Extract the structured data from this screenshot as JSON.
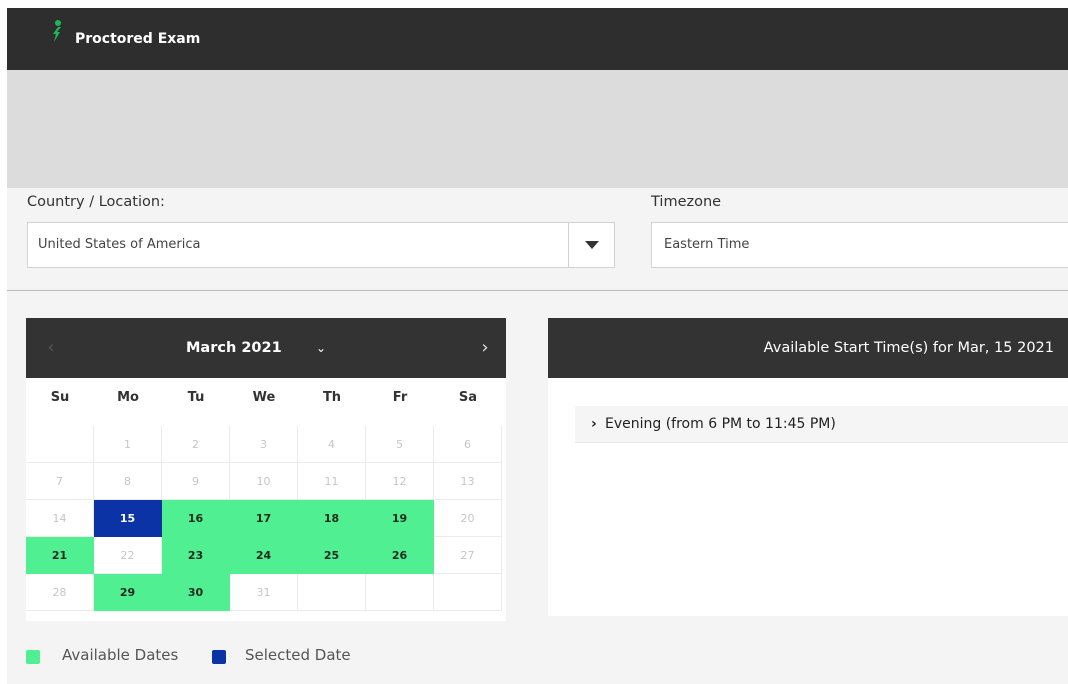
{
  "app": {
    "title": "Proctored Exam",
    "logo_icon": "leaf-person-icon",
    "brand_color": "#1fb65a"
  },
  "location": {
    "label": "Country / Location:",
    "value": "United States of America",
    "dropdown_icon": "triangle-down-icon"
  },
  "timezone": {
    "label": "Timezone",
    "value": "Eastern Time"
  },
  "calendar": {
    "month_label": "March 2021",
    "prev_icon": "chevron-left-icon",
    "next_icon": "chevron-right-icon",
    "month_dropdown_icon": "chevron-down-icon",
    "weekdays": [
      "Su",
      "Mo",
      "Tu",
      "We",
      "Th",
      "Fr",
      "Sa"
    ],
    "weeks": [
      [
        "",
        "1",
        "2",
        "3",
        "4",
        "5",
        "6"
      ],
      [
        "7",
        "8",
        "9",
        "10",
        "11",
        "12",
        "13"
      ],
      [
        "14",
        "15",
        "16",
        "17",
        "18",
        "19",
        "20"
      ],
      [
        "21",
        "22",
        "23",
        "24",
        "25",
        "26",
        "27"
      ],
      [
        "28",
        "29",
        "30",
        "31",
        "",
        "",
        ""
      ]
    ],
    "available_dates": [
      "16",
      "17",
      "18",
      "19",
      "21",
      "23",
      "24",
      "25",
      "26",
      "29",
      "30"
    ],
    "selected_date": "15",
    "available_color": "#50ef92",
    "selected_color": "#0c33a5"
  },
  "legend": {
    "available": "Available Dates",
    "selected": "Selected Date"
  },
  "times": {
    "title": "Available Start Time(s) for Mar, 15 2021",
    "slots": [
      {
        "label": "Evening (from 6 PM to 11:45 PM)",
        "icon": "chevron-right-icon"
      }
    ]
  }
}
